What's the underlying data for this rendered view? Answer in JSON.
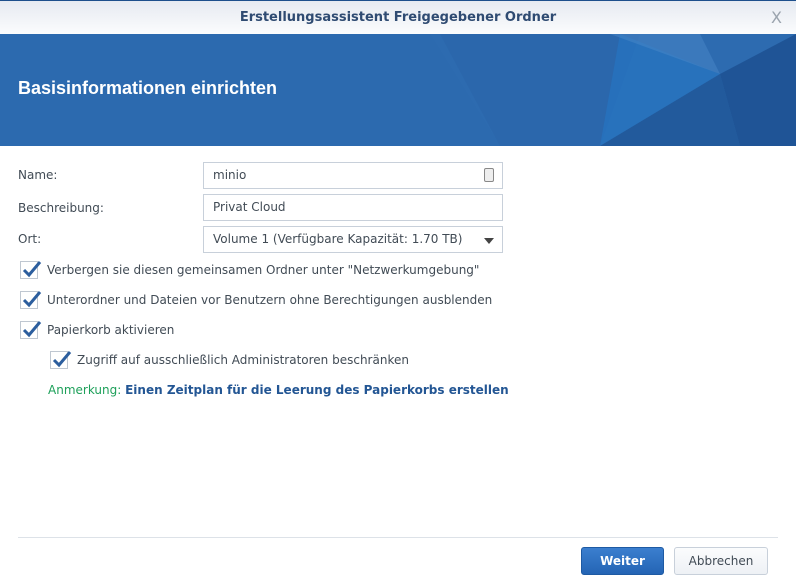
{
  "window": {
    "title": "Erstellungsassistent Freigegebener Ordner",
    "close": "X"
  },
  "banner": {
    "title": "Basisinformationen einrichten"
  },
  "form": {
    "name_label": "Name:",
    "name_value": "minio",
    "desc_label": "Beschreibung:",
    "desc_value": "Privat Cloud",
    "location_label": "Ort:",
    "location_value": "Volume 1 (Verfügbare Kapazität:  1.70 TB)"
  },
  "checkboxes": [
    {
      "label": "Verbergen sie diesen gemeinsamen Ordner unter \"Netzwerkumgebung\"",
      "checked": true
    },
    {
      "label": "Unterordner und Dateien vor Benutzern ohne Berechtigungen ausblenden",
      "checked": true
    },
    {
      "label": "Papierkorb aktivieren",
      "checked": true
    },
    {
      "label": "Zugriff auf ausschließlich Administratoren beschränken",
      "checked": true
    }
  ],
  "note": {
    "prefix": "Anmerkung:",
    "link": "Einen Zeitplan für die Leerung des Papierkorbs erstellen"
  },
  "buttons": {
    "next": "Weiter",
    "cancel": "Abbrechen"
  }
}
